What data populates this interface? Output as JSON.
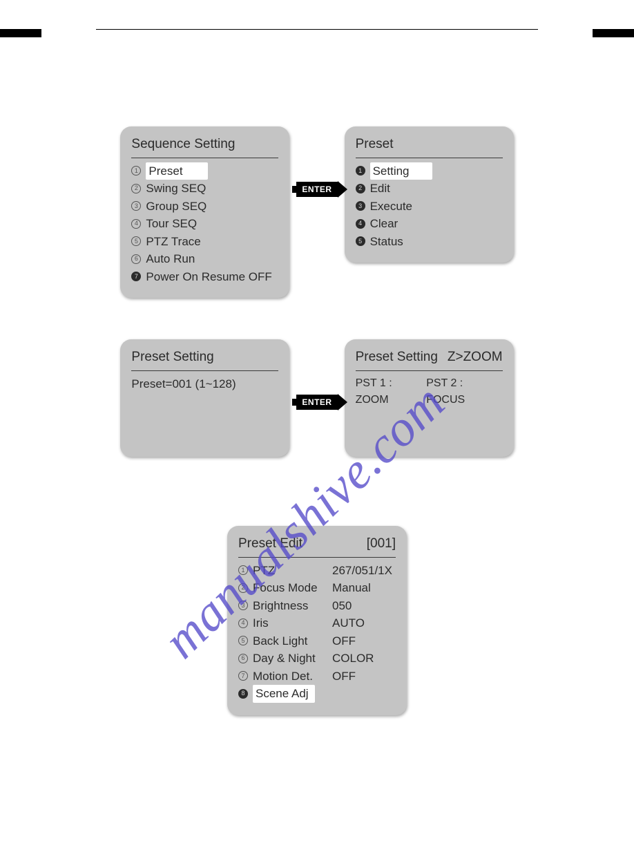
{
  "watermark": "manualshive.com",
  "enter_label": "ENTER",
  "row1": {
    "left": {
      "title": "Sequence Setting",
      "items": [
        {
          "num": "1",
          "filled": false,
          "label": "Preset",
          "highlight": true
        },
        {
          "num": "2",
          "filled": false,
          "label": "Swing SEQ"
        },
        {
          "num": "3",
          "filled": false,
          "label": "Group SEQ"
        },
        {
          "num": "4",
          "filled": false,
          "label": "Tour SEQ"
        },
        {
          "num": "5",
          "filled": false,
          "label": "PTZ Trace"
        },
        {
          "num": "6",
          "filled": false,
          "label": "Auto Run"
        },
        {
          "num": "7",
          "filled": true,
          "label": "Power On Resume OFF"
        }
      ]
    },
    "right": {
      "title": "Preset",
      "items": [
        {
          "num": "1",
          "filled": true,
          "label": "Setting",
          "highlight": true
        },
        {
          "num": "2",
          "filled": true,
          "label": "Edit"
        },
        {
          "num": "3",
          "filled": true,
          "label": "Execute"
        },
        {
          "num": "4",
          "filled": true,
          "label": "Clear"
        },
        {
          "num": "5",
          "filled": true,
          "label": "Status"
        }
      ]
    }
  },
  "row2": {
    "left": {
      "title": "Preset Setting",
      "body": "Preset=001 (1~128)"
    },
    "right": {
      "title_left": "Preset Setting",
      "title_right": "Z>ZOOM",
      "sub_left": "PST 1 : ZOOM",
      "sub_right": "PST 2 : FOCUS"
    }
  },
  "row3": {
    "title_left": "Preset Edit",
    "title_right": "[001]",
    "items": [
      {
        "num": "1",
        "filled": false,
        "k": "PTZ",
        "v": "267/051/1X"
      },
      {
        "num": "2",
        "filled": false,
        "k": "Focus Mode",
        "v": "Manual"
      },
      {
        "num": "3",
        "filled": false,
        "k": "Brightness",
        "v": "050"
      },
      {
        "num": "4",
        "filled": false,
        "k": "Iris",
        "v": "AUTO"
      },
      {
        "num": "5",
        "filled": false,
        "k": "Back Light",
        "v": "OFF"
      },
      {
        "num": "6",
        "filled": false,
        "k": "Day & Night",
        "v": "COLOR"
      },
      {
        "num": "7",
        "filled": false,
        "k": "Motion Det.",
        "v": "OFF"
      },
      {
        "num": "8",
        "filled": true,
        "k": "Scene Adj",
        "v": "",
        "highlight": true
      }
    ]
  }
}
